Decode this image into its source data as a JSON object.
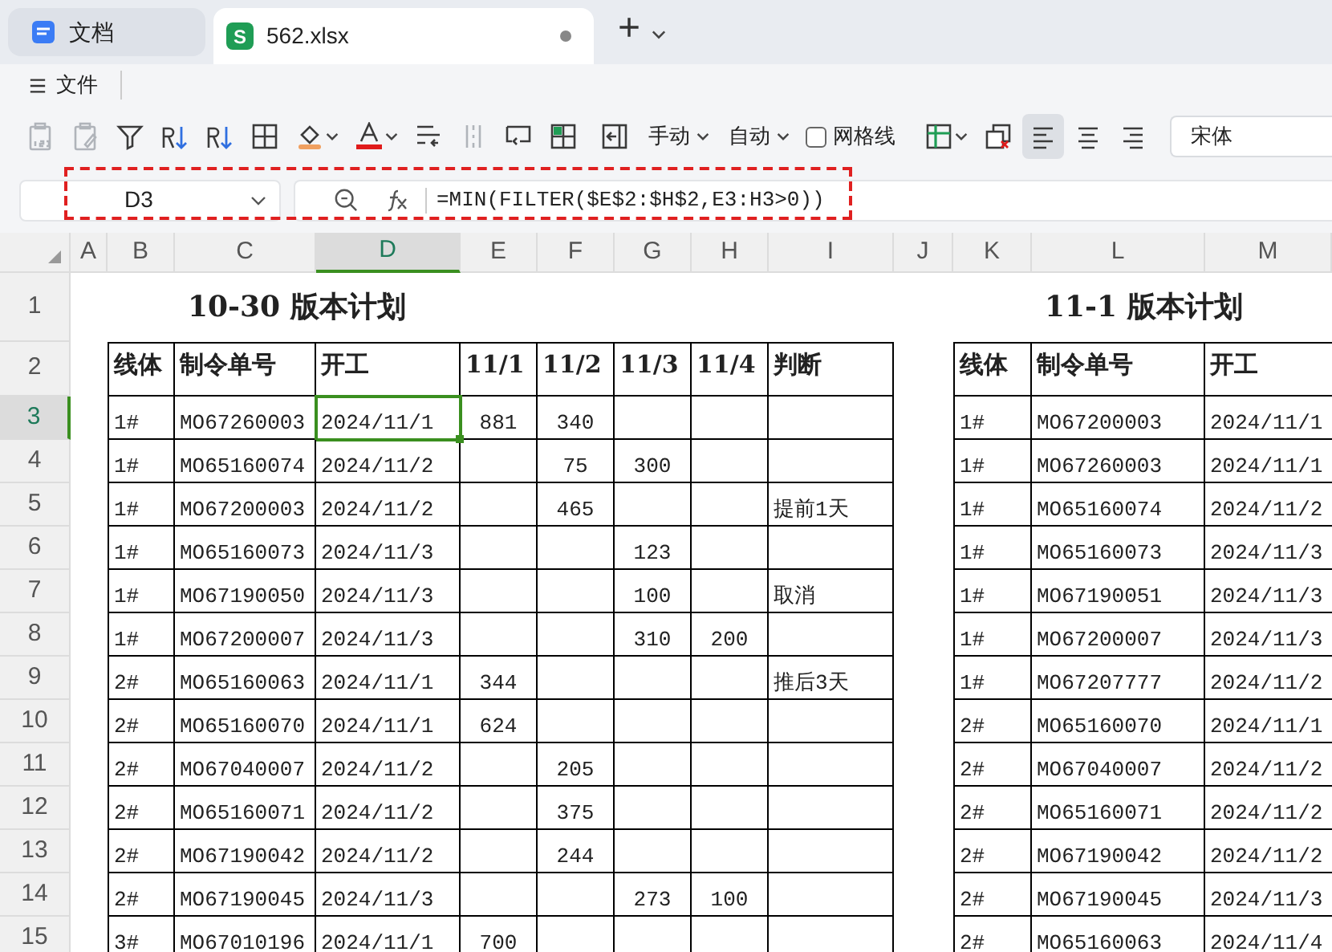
{
  "tabs": [
    {
      "label": "文档",
      "selected": false,
      "kind": "doc"
    },
    {
      "label": "562.xlsx",
      "selected": true,
      "kind": "sheet",
      "icon_text": "S",
      "unsaved": true
    }
  ],
  "new_tab": {
    "label": "+"
  },
  "menu": {
    "label": "文件"
  },
  "toolbar": [
    {
      "kind": "icon",
      "disabled": true,
      "selected": false
    },
    {
      "kind": "icon",
      "disabled": true,
      "selected": false
    },
    {
      "kind": "icon",
      "disabled": false,
      "selected": false
    },
    {
      "kind": "icon",
      "disabled": false,
      "selected": false
    },
    {
      "kind": "icon",
      "disabled": false,
      "selected": false
    },
    {
      "kind": "icon",
      "disabled": false,
      "selected": false
    },
    {
      "kind": "icon",
      "disabled": false,
      "selected": false
    },
    {
      "kind": "icon",
      "disabled": false,
      "selected": false
    },
    {
      "kind": "icon",
      "disabled": false,
      "selected": false
    },
    {
      "kind": "icon",
      "disabled": true,
      "selected": false
    },
    {
      "kind": "icon",
      "disabled": false,
      "selected": false
    },
    {
      "kind": "icon",
      "disabled": false,
      "selected": false
    },
    {
      "kind": "icon",
      "disabled": false,
      "selected": false
    },
    {
      "kind": "dropdown",
      "label": "手动"
    },
    {
      "kind": "dropdown",
      "label": "自动"
    },
    {
      "kind": "checkbox",
      "label": "网格线",
      "checked": false
    },
    {
      "kind": "icon",
      "disabled": false,
      "selected": false
    },
    {
      "kind": "icon",
      "disabled": false,
      "selected": false
    },
    {
      "kind": "icon",
      "disabled": false,
      "selected": true
    },
    {
      "kind": "icon",
      "disabled": false,
      "selected": false
    },
    {
      "kind": "icon",
      "disabled": false,
      "selected": false
    },
    {
      "kind": "field",
      "value": "宋体"
    }
  ],
  "formula_bar": {
    "cell_ref": "D3",
    "formula": "=MIN(FILTER($E$2:$H$2,E3:H3>0))"
  },
  "sheet": {
    "columns": [
      {
        "label": "A",
        "selected": false
      },
      {
        "label": "B",
        "selected": false
      },
      {
        "label": "C",
        "selected": false
      },
      {
        "label": "D",
        "selected": true
      },
      {
        "label": "E",
        "selected": false
      },
      {
        "label": "F",
        "selected": false
      },
      {
        "label": "G",
        "selected": false
      },
      {
        "label": "H",
        "selected": false
      },
      {
        "label": "I",
        "selected": false
      },
      {
        "label": "J",
        "selected": false
      },
      {
        "label": "K",
        "selected": false
      },
      {
        "label": "L",
        "selected": false
      },
      {
        "label": "M",
        "selected": false
      }
    ],
    "rows": [
      {
        "label": "1",
        "selected": false,
        "cells": {
          "C": "10-30 版本计划",
          "L": "11-1 版本计划"
        }
      },
      {
        "label": "2",
        "selected": false,
        "cells": {
          "B": "线体",
          "C": "制令单号",
          "D": "开工",
          "E": "11/1",
          "F": "11/2",
          "G": "11/3",
          "H": "11/4",
          "I": "判断",
          "K": "线体",
          "L": "制令单号",
          "M": "开工"
        }
      },
      {
        "label": "3",
        "selected": true,
        "cells": {
          "B": "1#",
          "C": "MO67260003",
          "D": "2024/11/1",
          "E": "881",
          "F": "340",
          "K": "1#",
          "L": "MO67200003",
          "M": "2024/11/1"
        }
      },
      {
        "label": "4",
        "selected": false,
        "cells": {
          "B": "1#",
          "C": "MO65160074",
          "D": "2024/11/2",
          "F": "75",
          "G": "300",
          "K": "1#",
          "L": "MO67260003",
          "M": "2024/11/1"
        }
      },
      {
        "label": "5",
        "selected": false,
        "cells": {
          "B": "1#",
          "C": "MO67200003",
          "D": "2024/11/2",
          "F": "465",
          "I": "提前1天",
          "K": "1#",
          "L": "MO65160074",
          "M": "2024/11/2"
        }
      },
      {
        "label": "6",
        "selected": false,
        "cells": {
          "B": "1#",
          "C": "MO65160073",
          "D": "2024/11/3",
          "G": "123",
          "K": "1#",
          "L": "MO65160073",
          "M": "2024/11/3"
        }
      },
      {
        "label": "7",
        "selected": false,
        "cells": {
          "B": "1#",
          "C": "MO67190050",
          "D": "2024/11/3",
          "G": "100",
          "I": "取消",
          "K": "1#",
          "L": "MO67190051",
          "M": "2024/11/3"
        }
      },
      {
        "label": "8",
        "selected": false,
        "cells": {
          "B": "1#",
          "C": "MO67200007",
          "D": "2024/11/3",
          "G": "310",
          "H": "200",
          "K": "1#",
          "L": "MO67200007",
          "M": "2024/11/3"
        }
      },
      {
        "label": "9",
        "selected": false,
        "cells": {
          "B": "2#",
          "C": "MO65160063",
          "D": "2024/11/1",
          "E": "344",
          "I": "推后3天",
          "K": "1#",
          "L": "MO67207777",
          "M": "2024/11/2"
        }
      },
      {
        "label": "10",
        "selected": false,
        "cells": {
          "B": "2#",
          "C": "MO65160070",
          "D": "2024/11/1",
          "E": "624",
          "K": "2#",
          "L": "MO65160070",
          "M": "2024/11/1"
        }
      },
      {
        "label": "11",
        "selected": false,
        "cells": {
          "B": "2#",
          "C": "MO67040007",
          "D": "2024/11/2",
          "F": "205",
          "K": "2#",
          "L": "MO67040007",
          "M": "2024/11/2"
        }
      },
      {
        "label": "12",
        "selected": false,
        "cells": {
          "B": "2#",
          "C": "MO65160071",
          "D": "2024/11/2",
          "F": "375",
          "K": "2#",
          "L": "MO65160071",
          "M": "2024/11/2"
        }
      },
      {
        "label": "13",
        "selected": false,
        "cells": {
          "B": "2#",
          "C": "MO67190042",
          "D": "2024/11/2",
          "F": "244",
          "K": "2#",
          "L": "MO67190042",
          "M": "2024/11/2"
        }
      },
      {
        "label": "14",
        "selected": false,
        "cells": {
          "B": "2#",
          "C": "MO67190045",
          "D": "2024/11/3",
          "G": "273",
          "H": "100",
          "K": "2#",
          "L": "MO67190045",
          "M": "2024/11/3"
        }
      },
      {
        "label": "15",
        "selected": false,
        "cells": {
          "B": "3#",
          "C": "MO67010196",
          "D": "2024/11/1",
          "E": "700",
          "K": "2#",
          "L": "MO65160063",
          "M": "2024/11/4"
        }
      }
    ]
  }
}
